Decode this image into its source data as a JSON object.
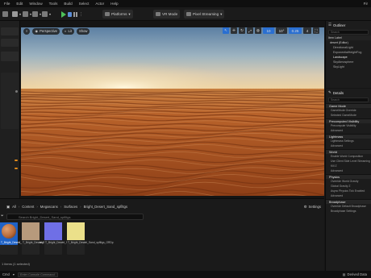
{
  "menu": [
    "File",
    "Edit",
    "Window",
    "Tools",
    "Build",
    "Select",
    "Actor",
    "Help"
  ],
  "window_right": "Fir",
  "toolbar": {
    "platforms_label": "Platforms",
    "vr_label": "VR Mode",
    "pixel_streaming_label": "Pixel Streaming"
  },
  "viewport": {
    "perspective_label": "Perspective",
    "lit_label": "Lit",
    "show_label": "Show",
    "snap_grid": "10",
    "snap_rot": "10°",
    "snap_scale": "0.25",
    "camera_speed": "4"
  },
  "content_browser": {
    "path": [
      "All",
      "Content",
      "Megascans",
      "Surfaces",
      "Bright_Desert_Sand_spfiltgs"
    ],
    "settings_label": "Settings",
    "search_placeholder": "Search Bright_Desert_Sand_spfiltgs",
    "assets": [
      {
        "label": "T_Bright_Desert_Sand_spfiltgs_Inst",
        "color": "#b86a3a"
      },
      {
        "label": "T_Bright_Desert_Sand_spfiltgs_D",
        "color": "#b79a7c"
      },
      {
        "label": "T_Bright_Desert_Sand_spfiltgs_N",
        "color": "#6f6fe6"
      },
      {
        "label": "T_Bright_Desert_Sand_spfiltgs_ORDp",
        "color": "#ebe08a"
      }
    ],
    "status": "1 items (1 selected)"
  },
  "bottom_bar": {
    "cmd_label": "Cmd",
    "cmd_placeholder": "Enter Console Command",
    "derived_data": "Derived Data"
  },
  "outliner": {
    "title": "Outliner",
    "search_placeholder": "Search",
    "column": "Item Label",
    "items": [
      "desert (Editor)",
      "DirectionalLight",
      "ExponentialHeightFog",
      "Landscape",
      "SkyAtmosphere",
      "SkyLight"
    ]
  },
  "details": {
    "tab": "Details",
    "search_placeholder": "Search",
    "sections": [
      {
        "title": "Game Mode",
        "rows": [
          "GameMode Override",
          "Selected GameMode"
        ]
      },
      {
        "title": "Precomputed Visibility",
        "rows": [
          "Precompute Visibility",
          "Advanced"
        ]
      },
      {
        "title": "Lightmass",
        "rows": [
          "Lightmass Settings",
          "Advanced"
        ]
      },
      {
        "title": "World",
        "rows": [
          "Enable World Composition",
          "Use Client Side Level Streaming",
          "Kill Z",
          "Advanced"
        ]
      },
      {
        "title": "Physics",
        "rows": [
          "Override World Gravity",
          "Global Gravity Z",
          "Async Physics Tick Enabled",
          "Advanced"
        ]
      },
      {
        "title": "Broadphase",
        "rows": [
          "Override Default Broadphase",
          "Broadphase Settings"
        ]
      }
    ]
  },
  "colors": {
    "accent": "#2a6fd1",
    "play": "#4ec25a",
    "selected_asset": "#1f62c6"
  }
}
